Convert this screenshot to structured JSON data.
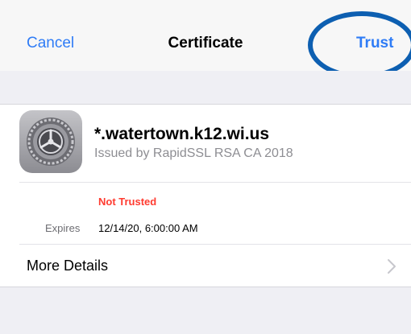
{
  "nav": {
    "cancel_label": "Cancel",
    "title": "Certificate",
    "trust_label": "Trust"
  },
  "certificate": {
    "icon": "settings-gear-icon",
    "name": "*.watertown.k12.wi.us",
    "issuer": "Issued by RapidSSL RSA CA 2018",
    "status": "Not Trusted",
    "expires_label": "Expires",
    "expires_value": "12/14/20, 6:00:00 AM"
  },
  "details": {
    "more_label": "More Details",
    "chevron_icon": "chevron-right-icon"
  },
  "colors": {
    "accent": "#2f7cf6",
    "annotation": "#0d5fb1",
    "status_error": "#ff3b30"
  }
}
